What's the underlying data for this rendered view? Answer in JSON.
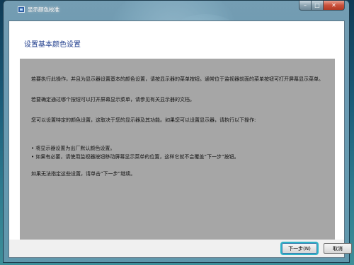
{
  "window": {
    "title": "显示颜色校准",
    "controls": {
      "minimize": "–",
      "maximize": "□",
      "close": "✕"
    }
  },
  "page": {
    "heading": "设置基本颜色设置",
    "paragraphs": [
      "若要执行此操作，并且为显示器设置基本的颜色设置，请按显示器的菜单按钮。通常位于监视器前面的菜单按钮可打开屏幕显示菜单。",
      "若要确定通过哪个按钮可以打开屏幕显示菜单，请参见有关显示器的文档。",
      "您可以设置特定的颜色设置，这取决于您的显示器及其功能。如果您可以设置显示器，请执行以下操作:"
    ],
    "bullets": [
      "• 将显示器设置为出厂默认颜色设置。",
      "• 如果有必要，请使用监视器按钮移动屏幕显示菜单的位置，这样它就不会覆盖“下一步”按钮。"
    ],
    "closing": "如果无法指定这些设置，请单击“下一步”继续。"
  },
  "buttons": {
    "next": "下一步(N)",
    "cancel": "取消"
  },
  "colors": {
    "content_bg": "#a6a6a6",
    "heading": "#1e3c8c",
    "focus_ring": "#2fb3c7"
  }
}
